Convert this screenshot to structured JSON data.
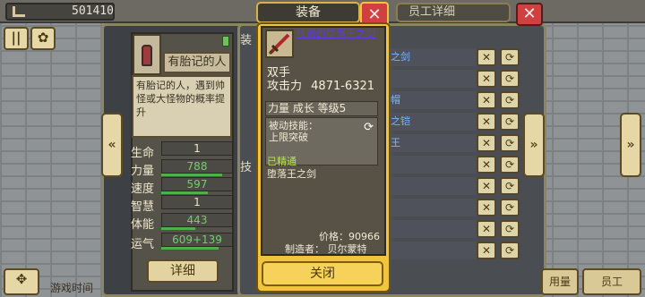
{
  "topbar": {
    "coins": "501410"
  },
  "character": {
    "name": "有胎记的人",
    "description": "有胎记的人，遇到帅怪或大怪物的概率提升",
    "stats": [
      {
        "label": "生命",
        "value": "1",
        "fill": 0.0
      },
      {
        "label": "力量",
        "value": "788",
        "fill": 0.85
      },
      {
        "label": "速度",
        "value": "597",
        "fill": 0.65
      },
      {
        "label": "智慧",
        "value": "1",
        "fill": 0.0
      },
      {
        "label": "体能",
        "value": "443",
        "fill": 0.48
      },
      {
        "label": "运气",
        "value": "609+139",
        "fill": 0.8
      }
    ],
    "detail_button": "详细",
    "side_tab_top": "装",
    "side_tab_mid": "技"
  },
  "right_panel": {
    "title": "员工详细",
    "rows": [
      {
        "text": "之剑"
      },
      {
        "text": ""
      },
      {
        "text": "帽"
      },
      {
        "text": "之铠"
      },
      {
        "text": "王"
      },
      {
        "text": ""
      },
      {
        "text": ""
      },
      {
        "text": ""
      },
      {
        "text": ""
      },
      {
        "text": ""
      }
    ]
  },
  "equipment": {
    "panel_title": "装备",
    "weapon_name": "传奇的堕落王之剑",
    "type": "双手",
    "attack_label": "攻击力",
    "attack_value": "4871-6321",
    "attribute": "力量  成长  等级5",
    "skill_label": "被动技能：",
    "skill_value": "上限突破",
    "mastered": "已精通",
    "mastered_skill": "堕落王之剑",
    "price": "价格：90966",
    "maker": "制造者：  贝尔蒙特",
    "close_button": "关闭"
  },
  "bottom": {
    "game_time_label": "游戏时间",
    "btn_a": "用量",
    "btn_b": "员工"
  },
  "colors": {
    "gold_panel": "#f0c43f",
    "close_red": "#d04040",
    "legendary_name": "#5b3cd6",
    "stat_bar": "#4db04a"
  }
}
